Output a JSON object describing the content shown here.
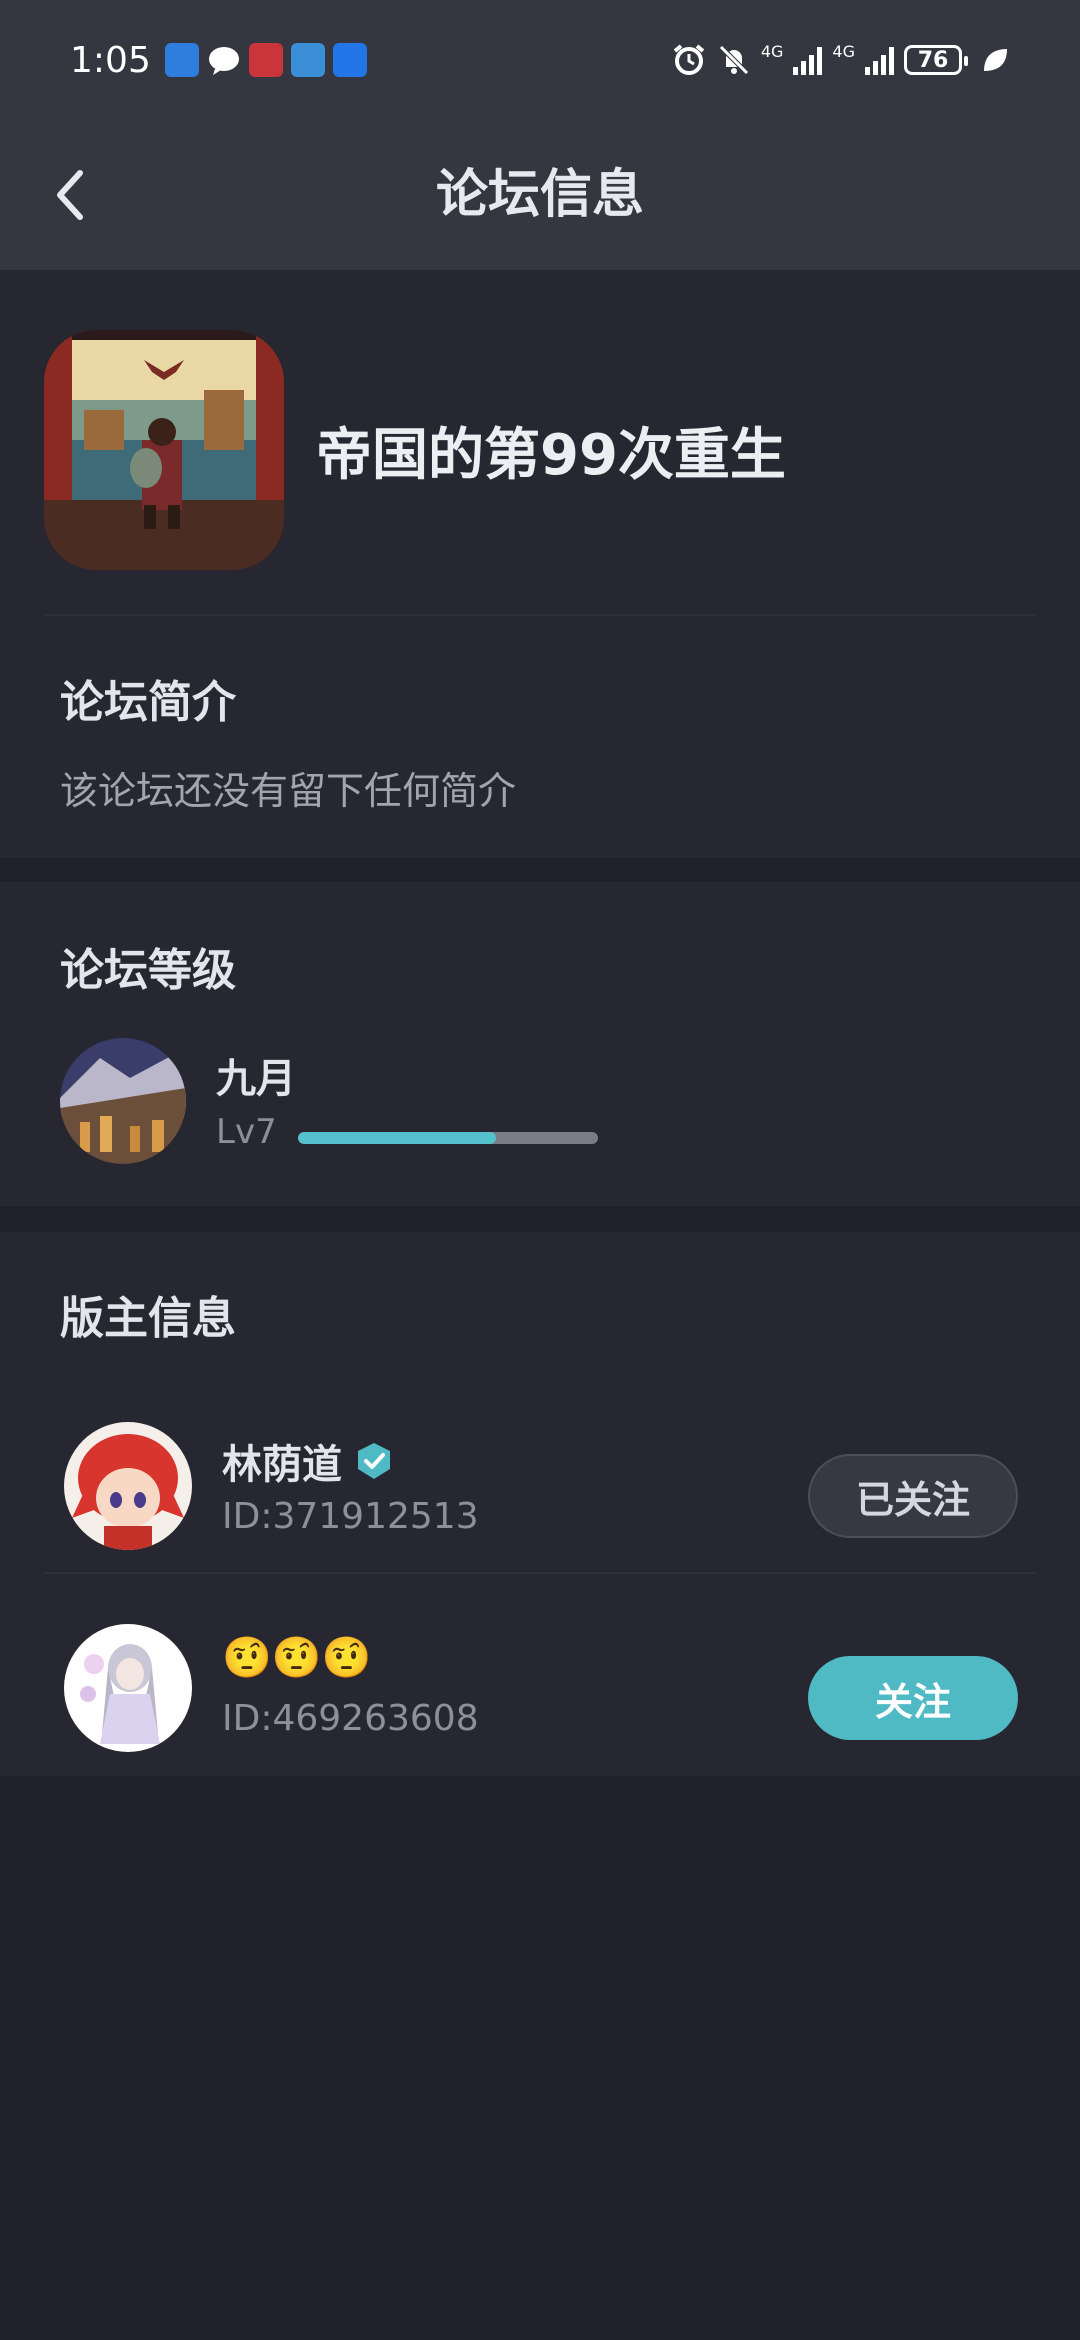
{
  "status_bar": {
    "time": "1:05",
    "network_1": "4G",
    "network_2": "4G",
    "battery": "76"
  },
  "header": {
    "title": "论坛信息",
    "back_icon": "chevron-left-icon"
  },
  "forum": {
    "name": "帝国的第99次重生",
    "intro_title": "论坛简介",
    "intro_text": "该论坛还没有留下任何简介"
  },
  "level": {
    "section_title": "论坛等级",
    "name": "九月",
    "badge": "Lv7",
    "progress": 0.66,
    "progress_color": "#55c1cc"
  },
  "moderators": {
    "section_title": "版主信息",
    "items": [
      {
        "name": "林荫道",
        "id": "ID:371912513",
        "verified": true,
        "button": "已关注"
      },
      {
        "name": "🤨🤨🤨",
        "id": "ID:469263608",
        "verified": false,
        "button": "关注"
      }
    ]
  },
  "colors": {
    "accent": "#4fb9c4",
    "background": "#1f2029",
    "card": "#262731",
    "header": "#343640"
  }
}
